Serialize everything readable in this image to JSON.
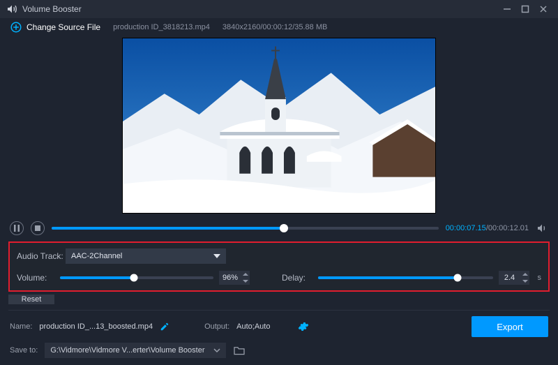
{
  "title": "Volume Booster",
  "source": {
    "change_label": "Change Source File",
    "filename": "production ID_3818213.mp4",
    "meta": "3840x2160/00:00:12/35.88 MB"
  },
  "playback": {
    "current_time": "00:00:07.15",
    "total_time": "00:00:12.01",
    "progress_pct": 60
  },
  "audio": {
    "track_label": "Audio Track:",
    "track_value": "AAC-2Channel",
    "volume_label": "Volume:",
    "volume_value": "96%",
    "volume_pct": 48,
    "delay_label": "Delay:",
    "delay_value": "2.4",
    "delay_unit": "s",
    "delay_pct": 80,
    "reset_label": "Reset"
  },
  "output": {
    "name_label": "Name:",
    "name_value": "production ID_...13_boosted.mp4",
    "output_label": "Output:",
    "output_value": "Auto;Auto",
    "save_label": "Save to:",
    "save_path": "G:\\Vidmore\\Vidmore V...erter\\Volume Booster",
    "export_label": "Export"
  }
}
